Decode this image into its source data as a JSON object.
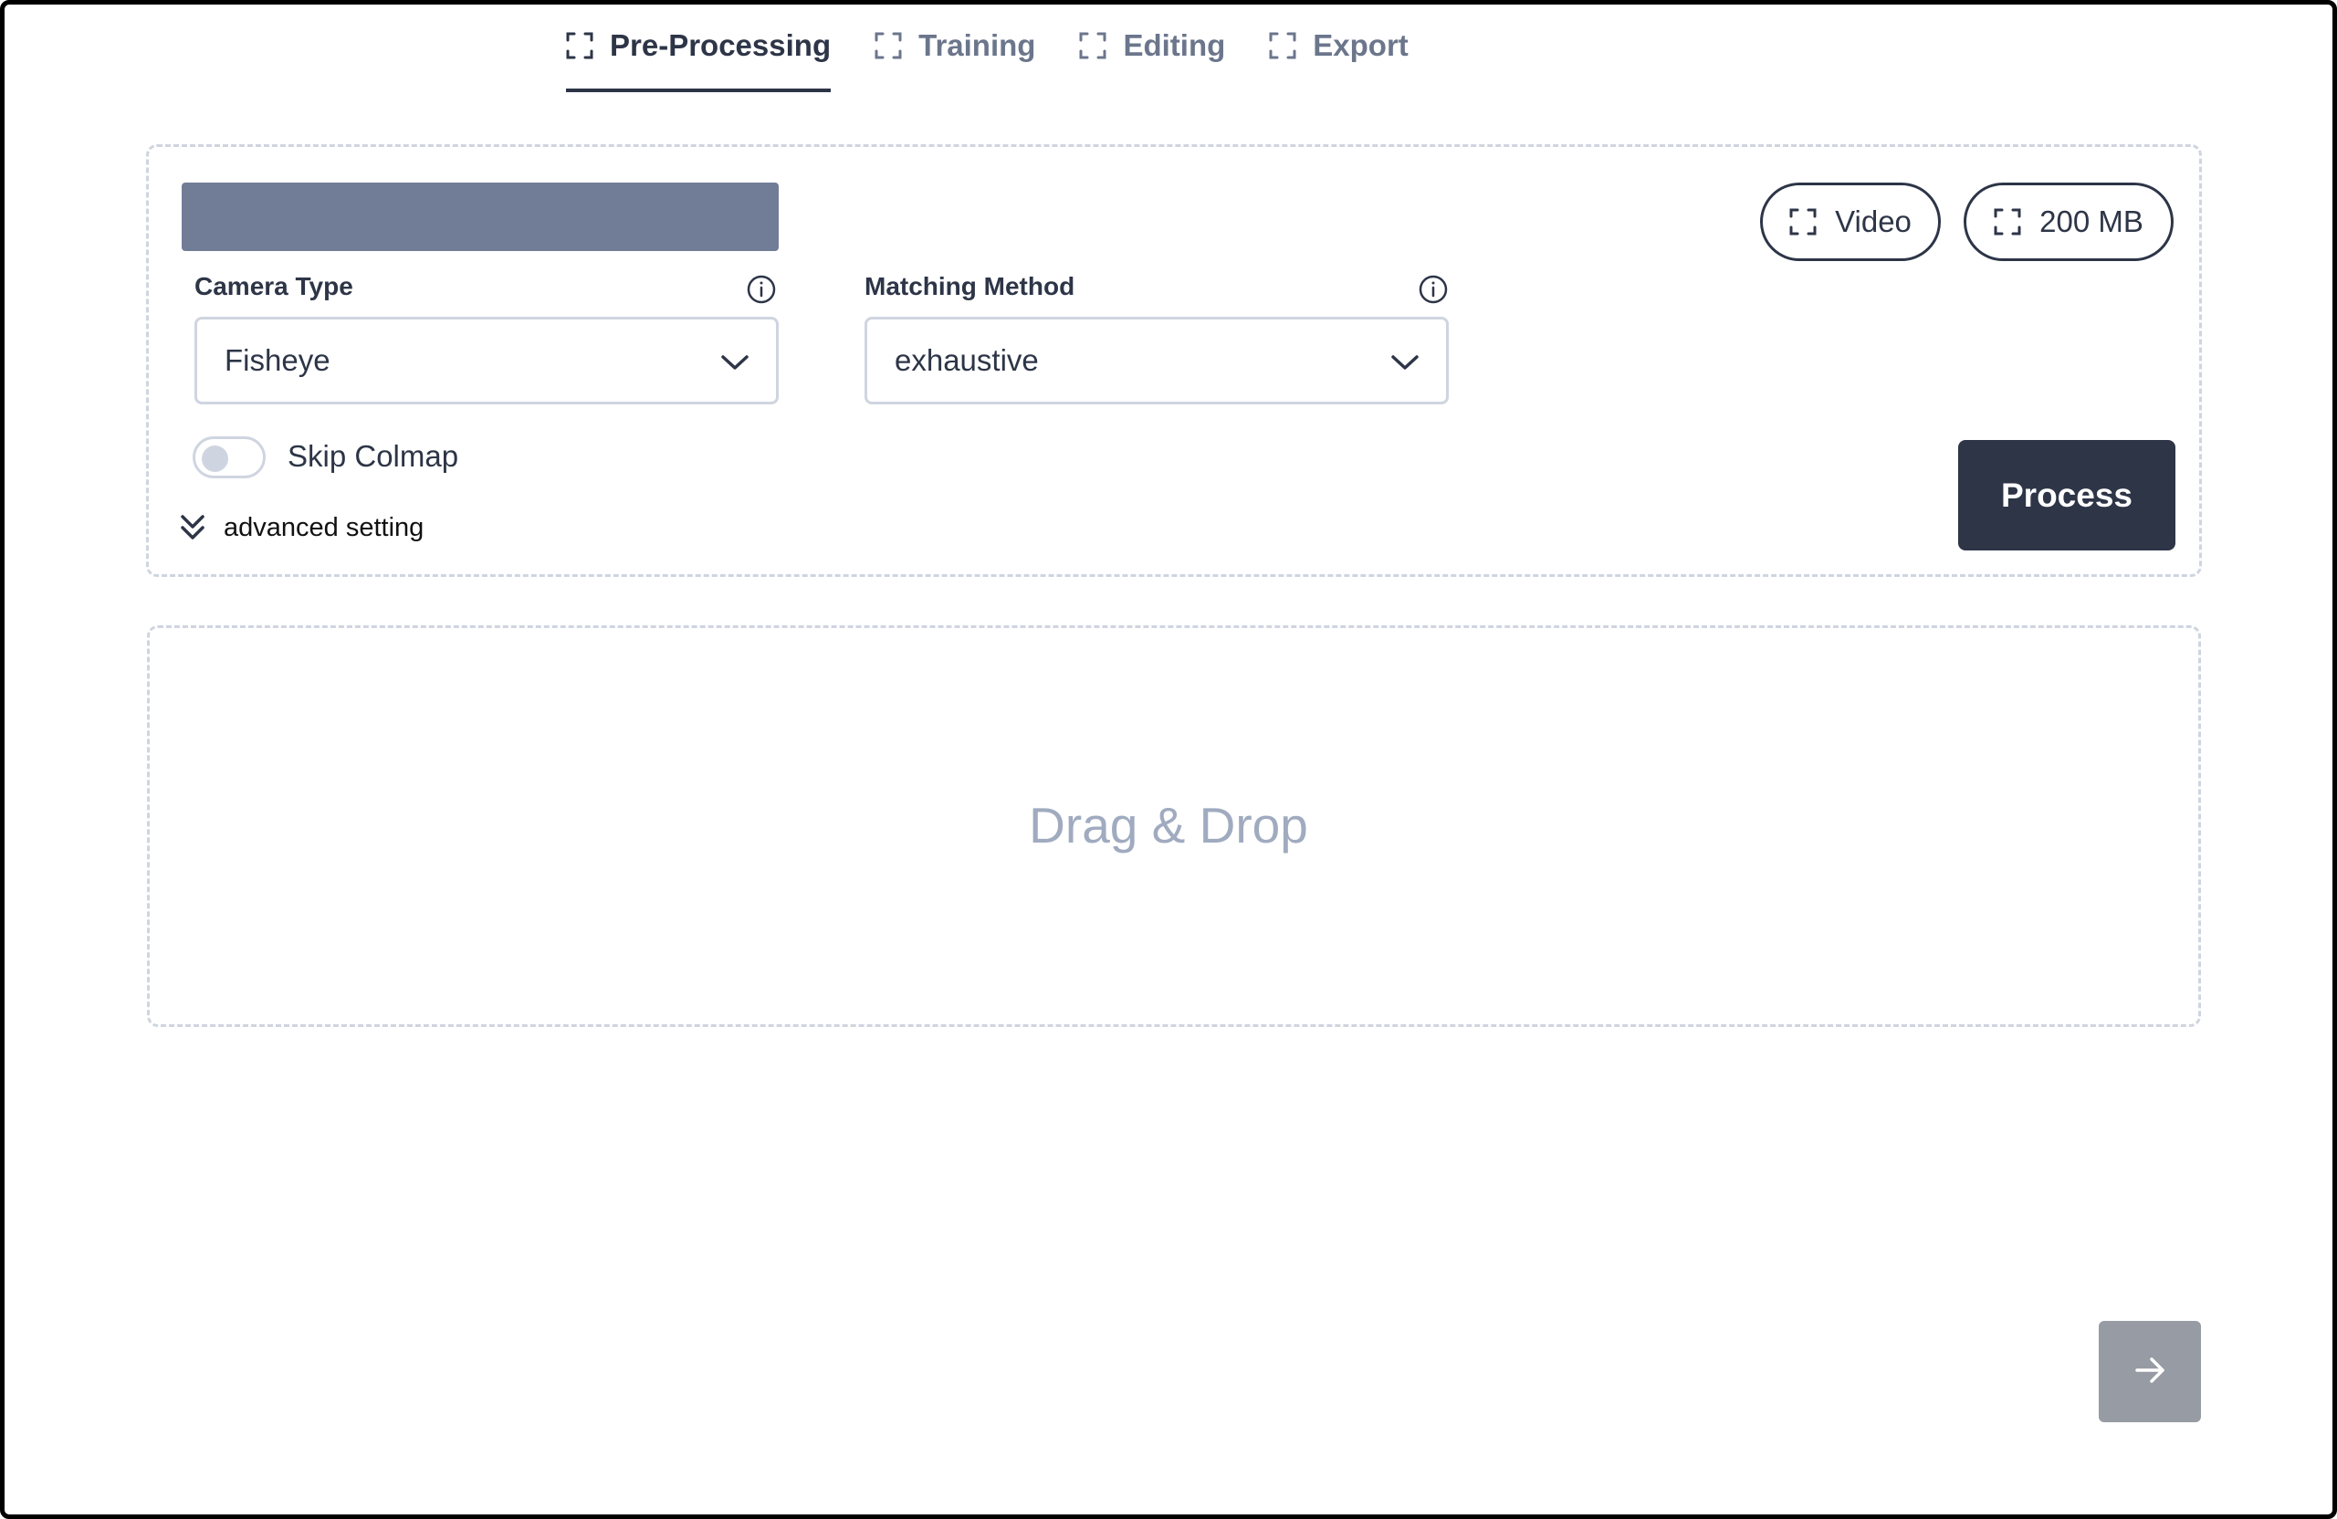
{
  "tabs": [
    {
      "label": "Pre-Processing",
      "active": true,
      "icon": "focus-frame-icon"
    },
    {
      "label": "Training",
      "active": false,
      "icon": "focus-frame-icon"
    },
    {
      "label": "Editing",
      "active": false,
      "icon": "focus-frame-icon"
    },
    {
      "label": "Export",
      "active": false,
      "icon": "focus-frame-icon"
    }
  ],
  "upload": {
    "chips": {
      "type_label": "Video",
      "size_label": "200 MB"
    }
  },
  "form": {
    "camera_type": {
      "label": "Camera Type",
      "value": "Fisheye"
    },
    "matching_method": {
      "label": "Matching Method",
      "value": "exhaustive"
    },
    "skip_colmap": {
      "label": "Skip Colmap",
      "checked": false
    },
    "advanced_label": "advanced setting",
    "process_label": "Process"
  },
  "dropzone": {
    "text": "Drag & Drop"
  },
  "colors": {
    "primary": "#2d3547",
    "muted": "#6b768c",
    "name_bar": "#717d96",
    "border": "#cfd5e0",
    "placeholder": "#a0abc0",
    "next_button": "#979ba3"
  }
}
